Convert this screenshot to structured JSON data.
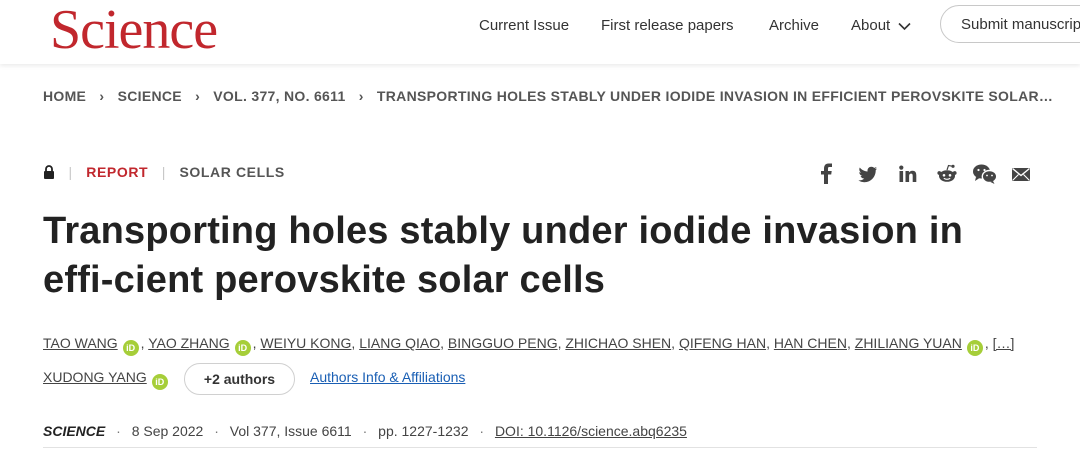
{
  "header": {
    "logo": "Science",
    "nav": [
      "Current Issue",
      "First release papers",
      "Archive",
      "About"
    ],
    "submit_label": "Submit manuscript"
  },
  "breadcrumb": [
    "HOME",
    "SCIENCE",
    "VOL. 377, NO. 6611",
    "TRANSPORTING HOLES STABLY UNDER IODIDE INVASION IN EFFICIENT PEROVSKITE SOLAR…"
  ],
  "article": {
    "type": "REPORT",
    "category": "SOLAR CELLS",
    "title": "Transporting holes stably under iodide invasion in effi-cient perovskite solar cells",
    "authors_line1": [
      "TAO WANG",
      "YAO ZHANG",
      "WEIYU KONG",
      "LIANG QIAO",
      "BINGGUO PENG",
      "ZHICHAO SHEN",
      "QIFENG HAN",
      "HAN CHEN",
      "ZHILIANG YUAN"
    ],
    "more": "[…]",
    "last_author": "XUDONG YANG",
    "more_authors": "+2 authors",
    "affiliations_link": "Authors Info & Affiliations",
    "orcid_label": "iD",
    "comma": ",",
    "journal": "SCIENCE",
    "date": "8 Sep 2022",
    "volume": "Vol 377, Issue 6611",
    "pages": "pp. 1227-1232",
    "doi": "DOI: 10.1126/science.abq6235",
    "separator": "·"
  },
  "icons": {
    "share": [
      "facebook-icon",
      "twitter-icon",
      "linkedin-icon",
      "reddit-icon",
      "wechat-icon",
      "email-icon"
    ],
    "lock": "lock-icon"
  },
  "colors": {
    "brand": "#c1272d",
    "orcid": "#a6ce39",
    "link": "#1a5fb4"
  }
}
